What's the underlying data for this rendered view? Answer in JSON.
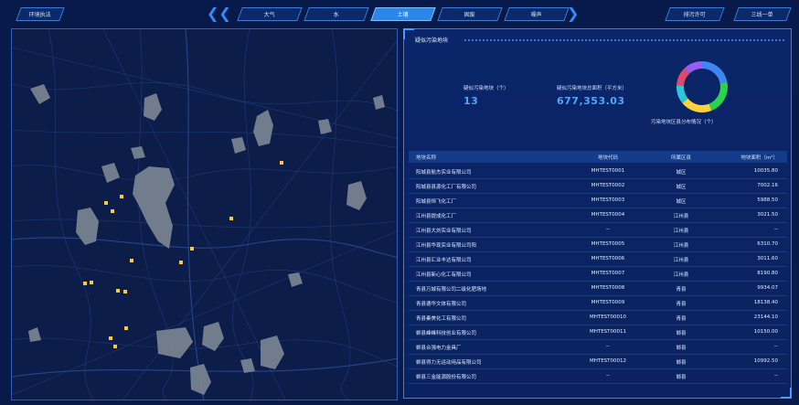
{
  "topnav": {
    "left_button": "环境执法",
    "tabs": [
      {
        "label": "大气",
        "active": false
      },
      {
        "label": "水",
        "active": false
      },
      {
        "label": "土壤",
        "active": true
      },
      {
        "label": "固废",
        "active": false
      },
      {
        "label": "噪声",
        "active": false
      }
    ],
    "right_buttons": [
      "排污许可",
      "三线一单"
    ]
  },
  "panel": {
    "title": "疑似污染地块",
    "stats": {
      "count_label": "疑似污染地块（个）",
      "count_value": "13",
      "area_label": "疑似污染地块总面积（平方米）",
      "area_value": "677,353.03"
    },
    "donut": {
      "label": "污染地块区县分布情况（个）",
      "segments": [
        {
          "color": "#3f86f0",
          "value": 0.22
        },
        {
          "color": "#2bd24b",
          "value": 0.22
        },
        {
          "color": "#ffd23a",
          "value": 0.2
        },
        {
          "color": "#2cc7d8",
          "value": 0.12
        },
        {
          "color": "#e04a6a",
          "value": 0.12
        },
        {
          "color": "#9a5cf0",
          "value": 0.12
        }
      ]
    },
    "table": {
      "headers": [
        "地块名称",
        "地块代码",
        "所属区县",
        "地块面积（m²）"
      ],
      "rows": [
        [
          "阳城县航杰实业有限公司",
          "MHTEST0001",
          "城区",
          "10035.80"
        ],
        [
          "阳城县县源化工厂有限公司",
          "MHTEST0002",
          "城区",
          "7002.16"
        ],
        [
          "阳城县恒飞化工厂",
          "MHTEST0003",
          "城区",
          "5988.50"
        ],
        [
          "江州县提成化工厂",
          "MHTEST0004",
          "江州县",
          "3021.50"
        ],
        [
          "江州县大刘实业有限公司",
          "--",
          "江州县",
          "--"
        ],
        [
          "江州县华现实业有限公司阳",
          "MHTEST0005",
          "江州县",
          "6310.70"
        ],
        [
          "江州县汇业丰达有限公司",
          "MHTEST0006",
          "江州县",
          "3011.60"
        ],
        [
          "江州县新心化工有限公司",
          "MHTEST0007",
          "江州县",
          "8190.80"
        ],
        [
          "青县万城有限公司二级化肥场地",
          "MHTEST0008",
          "青县",
          "9934.07"
        ],
        [
          "青县德华文体有限公司",
          "MHTEST0009",
          "青县",
          "18138.40"
        ],
        [
          "青县秦美化工有限公司",
          "MHTEST00010",
          "青县",
          "23144.10"
        ],
        [
          "郸县峰峰科技创业有限公司",
          "MHTEST00011",
          "郸县",
          "10150.00"
        ],
        [
          "郸县合强电力金具厂",
          "--",
          "郸县",
          "--"
        ],
        [
          "郸县得力无运动用品有限公司",
          "MHTEST00012",
          "郸县",
          "10992.50"
        ],
        [
          "郸县三金能源股份有限公司",
          "--",
          "郸县",
          "--"
        ]
      ]
    }
  }
}
